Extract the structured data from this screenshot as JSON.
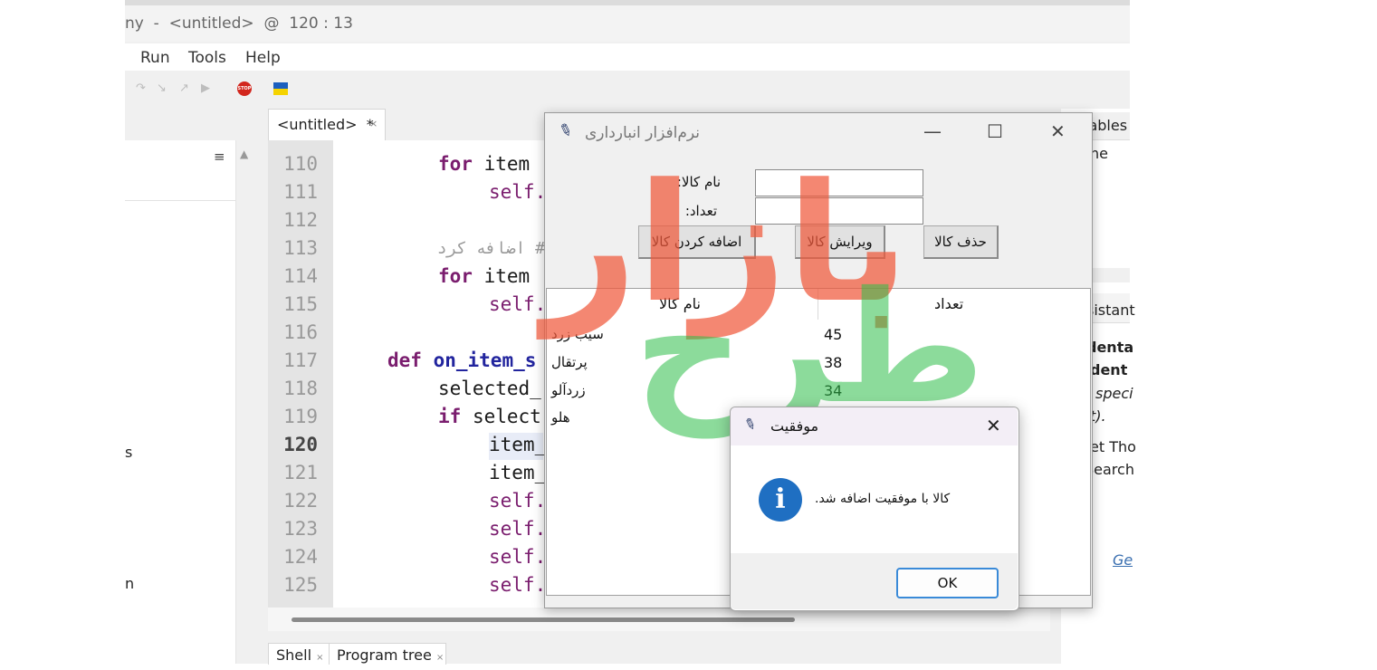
{
  "ide": {
    "title": "ny  -  <untitled>  @  120 : 13",
    "menu": [
      "Run",
      "Tools",
      "Help"
    ],
    "editor_tab": "<untitled>  *",
    "tab_close": "×",
    "outline_menu_glyph": "≡",
    "scroll_up_glyph": "▲",
    "left_fragments": [
      "s",
      "n"
    ],
    "line_numbers": [
      "110",
      "111",
      "112",
      "113",
      "114",
      "115",
      "116",
      "117",
      "118",
      "119",
      "120",
      "121",
      "122",
      "123",
      "124",
      "125"
    ],
    "bottom_tabs": [
      "Shell",
      "Program tree"
    ],
    "right_panel": {
      "variables_tab": "iables",
      "variables_text": "ne",
      "assistant_tab": "sistant",
      "lines": [
        "denta",
        "dent",
        "speci",
        "t).",
        "et Tho",
        "Search",
        "Ge"
      ]
    }
  },
  "code": {
    "l110_kw": "for",
    "l110_rest": " item",
    "l111_self": "self.",
    "l113_comment": "# اضافه کردن",
    "l114_kw": "for",
    "l114_rest": " item",
    "l115_self": "self.",
    "l117_kw": "def",
    "l117_fn": "on_item_s",
    "l118": "selected_",
    "l119_kw": "if",
    "l119_rest": " select",
    "l120": "item_",
    "l121": "item_",
    "l122": "self.",
    "l123": "self.",
    "l124": "self.",
    "l125": "self."
  },
  "app": {
    "title": "نرم‌افزار انبارداری",
    "minimize_glyph": "—",
    "maximize_glyph": "☐",
    "close_glyph": "✕",
    "label_name": "نام کالا:",
    "label_qty": "تعداد:",
    "btn_add": "اضافه کردن کالا",
    "btn_edit": "ویرایش کالا",
    "btn_delete": "حذف کالا",
    "tree_headers": [
      "نام کالا",
      "تعداد"
    ],
    "rows": [
      {
        "name": "سیب زرد",
        "qty": "45"
      },
      {
        "name": "پرتقال",
        "qty": "38"
      },
      {
        "name": "زردآلو",
        "qty": "34"
      },
      {
        "name": "هلو",
        "qty": ""
      }
    ]
  },
  "watermark": {
    "line1": "بازار",
    "line2": "طرح"
  },
  "dialog": {
    "title": "موفقیت",
    "close_glyph": "✕",
    "message": "کالا با موفقیت اضافه شد.",
    "icon_glyph": "i",
    "ok_label": "OK"
  }
}
